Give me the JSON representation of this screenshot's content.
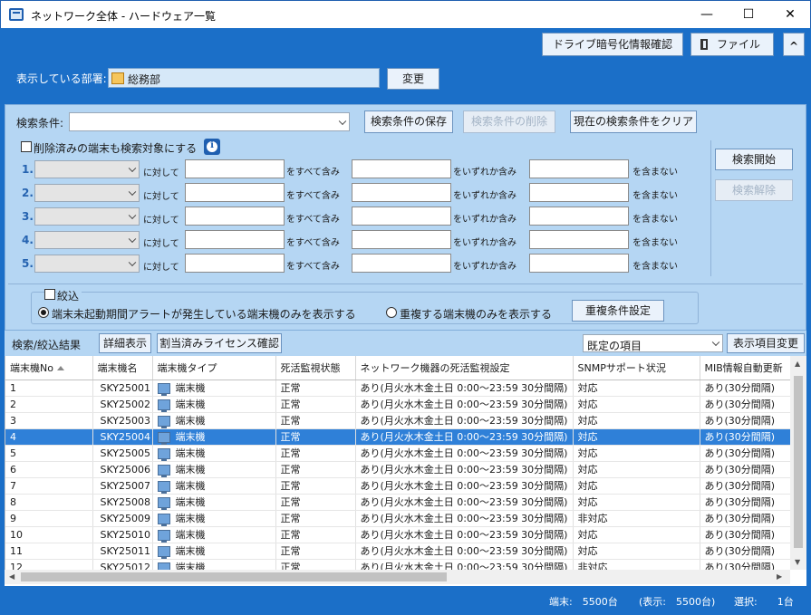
{
  "window": {
    "title": "ネットワーク全体 - ハードウェア一覧",
    "minimize": "—",
    "maximize": "☐",
    "close": "✕"
  },
  "toolbar": {
    "drive_encryption": "ドライブ暗号化情報確認",
    "file": "ファイル",
    "collapse": "^"
  },
  "department": {
    "label": "表示している部署:",
    "value": "総務部",
    "change": "変更"
  },
  "search": {
    "label": "検索条件:",
    "save": "検索条件の保存",
    "delete": "検索条件の削除",
    "clear": "現在の検索条件をクリア",
    "include_deleted": "削除済みの端末も検索対象にする",
    "info": "i",
    "start": "検索開始",
    "cancel": "検索解除",
    "rows": [
      {
        "num": "1.",
        "against": "に対して",
        "all": "をすべて含み",
        "any": "をいずれか含み",
        "none": "を含まない"
      },
      {
        "num": "2.",
        "against": "に対して",
        "all": "をすべて含み",
        "any": "をいずれか含み",
        "none": "を含まない"
      },
      {
        "num": "3.",
        "against": "に対して",
        "all": "をすべて含み",
        "any": "をいずれか含み",
        "none": "を含まない"
      },
      {
        "num": "4.",
        "against": "に対して",
        "all": "をすべて含み",
        "any": "をいずれか含み",
        "none": "を含まない"
      },
      {
        "num": "5.",
        "against": "に対して",
        "all": "をすべて含み",
        "any": "をいずれか含み",
        "none": "を含まない"
      }
    ]
  },
  "filter": {
    "title": "絞込",
    "option1": "端末未起動期間アラートが発生している端末機のみを表示する",
    "option2": "重複する端末機のみを表示する",
    "dup_settings": "重複条件設定"
  },
  "results": {
    "title": "検索/絞込結果",
    "details": "詳細表示",
    "license": "割当済みライセンス確認",
    "items_select": "既定の項目",
    "items_change": "表示項目変更"
  },
  "table": {
    "headers": [
      "端末機No",
      "端末機名",
      "端末機タイプ",
      "死活監視状態",
      "ネットワーク機器の死活監視設定",
      "SNMPサポート状況",
      "MIB情報自動更新"
    ],
    "rows": [
      [
        "1",
        "SKY25001",
        "端末機",
        "正常",
        "あり(月火水木金土日 0:00～23:59 30分間隔)",
        "対応",
        "あり(30分間隔)"
      ],
      [
        "2",
        "SKY25002",
        "端末機",
        "正常",
        "あり(月火水木金土日 0:00～23:59 30分間隔)",
        "対応",
        "あり(30分間隔)"
      ],
      [
        "3",
        "SKY25003",
        "端末機",
        "正常",
        "あり(月火水木金土日 0:00～23:59 30分間隔)",
        "対応",
        "あり(30分間隔)"
      ],
      [
        "4",
        "SKY25004",
        "端末機",
        "正常",
        "あり(月火水木金土日 0:00～23:59 30分間隔)",
        "対応",
        "あり(30分間隔)"
      ],
      [
        "5",
        "SKY25005",
        "端末機",
        "正常",
        "あり(月火水木金土日 0:00～23:59 30分間隔)",
        "対応",
        "あり(30分間隔)"
      ],
      [
        "6",
        "SKY25006",
        "端末機",
        "正常",
        "あり(月火水木金土日 0:00～23:59 30分間隔)",
        "対応",
        "あり(30分間隔)"
      ],
      [
        "7",
        "SKY25007",
        "端末機",
        "正常",
        "あり(月火水木金土日 0:00～23:59 30分間隔)",
        "対応",
        "あり(30分間隔)"
      ],
      [
        "8",
        "SKY25008",
        "端末機",
        "正常",
        "あり(月火水木金土日 0:00～23:59 30分間隔)",
        "対応",
        "あり(30分間隔)"
      ],
      [
        "9",
        "SKY25009",
        "端末機",
        "正常",
        "あり(月火水木金土日 0:00～23:59 30分間隔)",
        "非対応",
        "あり(30分間隔)"
      ],
      [
        "10",
        "SKY25010",
        "端末機",
        "正常",
        "あり(月火水木金土日 0:00～23:59 30分間隔)",
        "対応",
        "あり(30分間隔)"
      ],
      [
        "11",
        "SKY25011",
        "端末機",
        "正常",
        "あり(月火水木金土日 0:00～23:59 30分間隔)",
        "対応",
        "あり(30分間隔)"
      ],
      [
        "12",
        "SKY25012",
        "端末機",
        "正常",
        "あり(月火水木金土日 0:00～23:59 30分間隔)",
        "非対応",
        "あり(30分間隔)"
      ]
    ],
    "selected_row": 3
  },
  "status": {
    "terminals": "端末:　5500台",
    "displayed": "(表示:　5500台)",
    "selected": "選択:　　1台"
  },
  "colors": {
    "accent": "#1b6fc8",
    "panel": "#b5d6f3",
    "selection": "#2f80d8"
  }
}
